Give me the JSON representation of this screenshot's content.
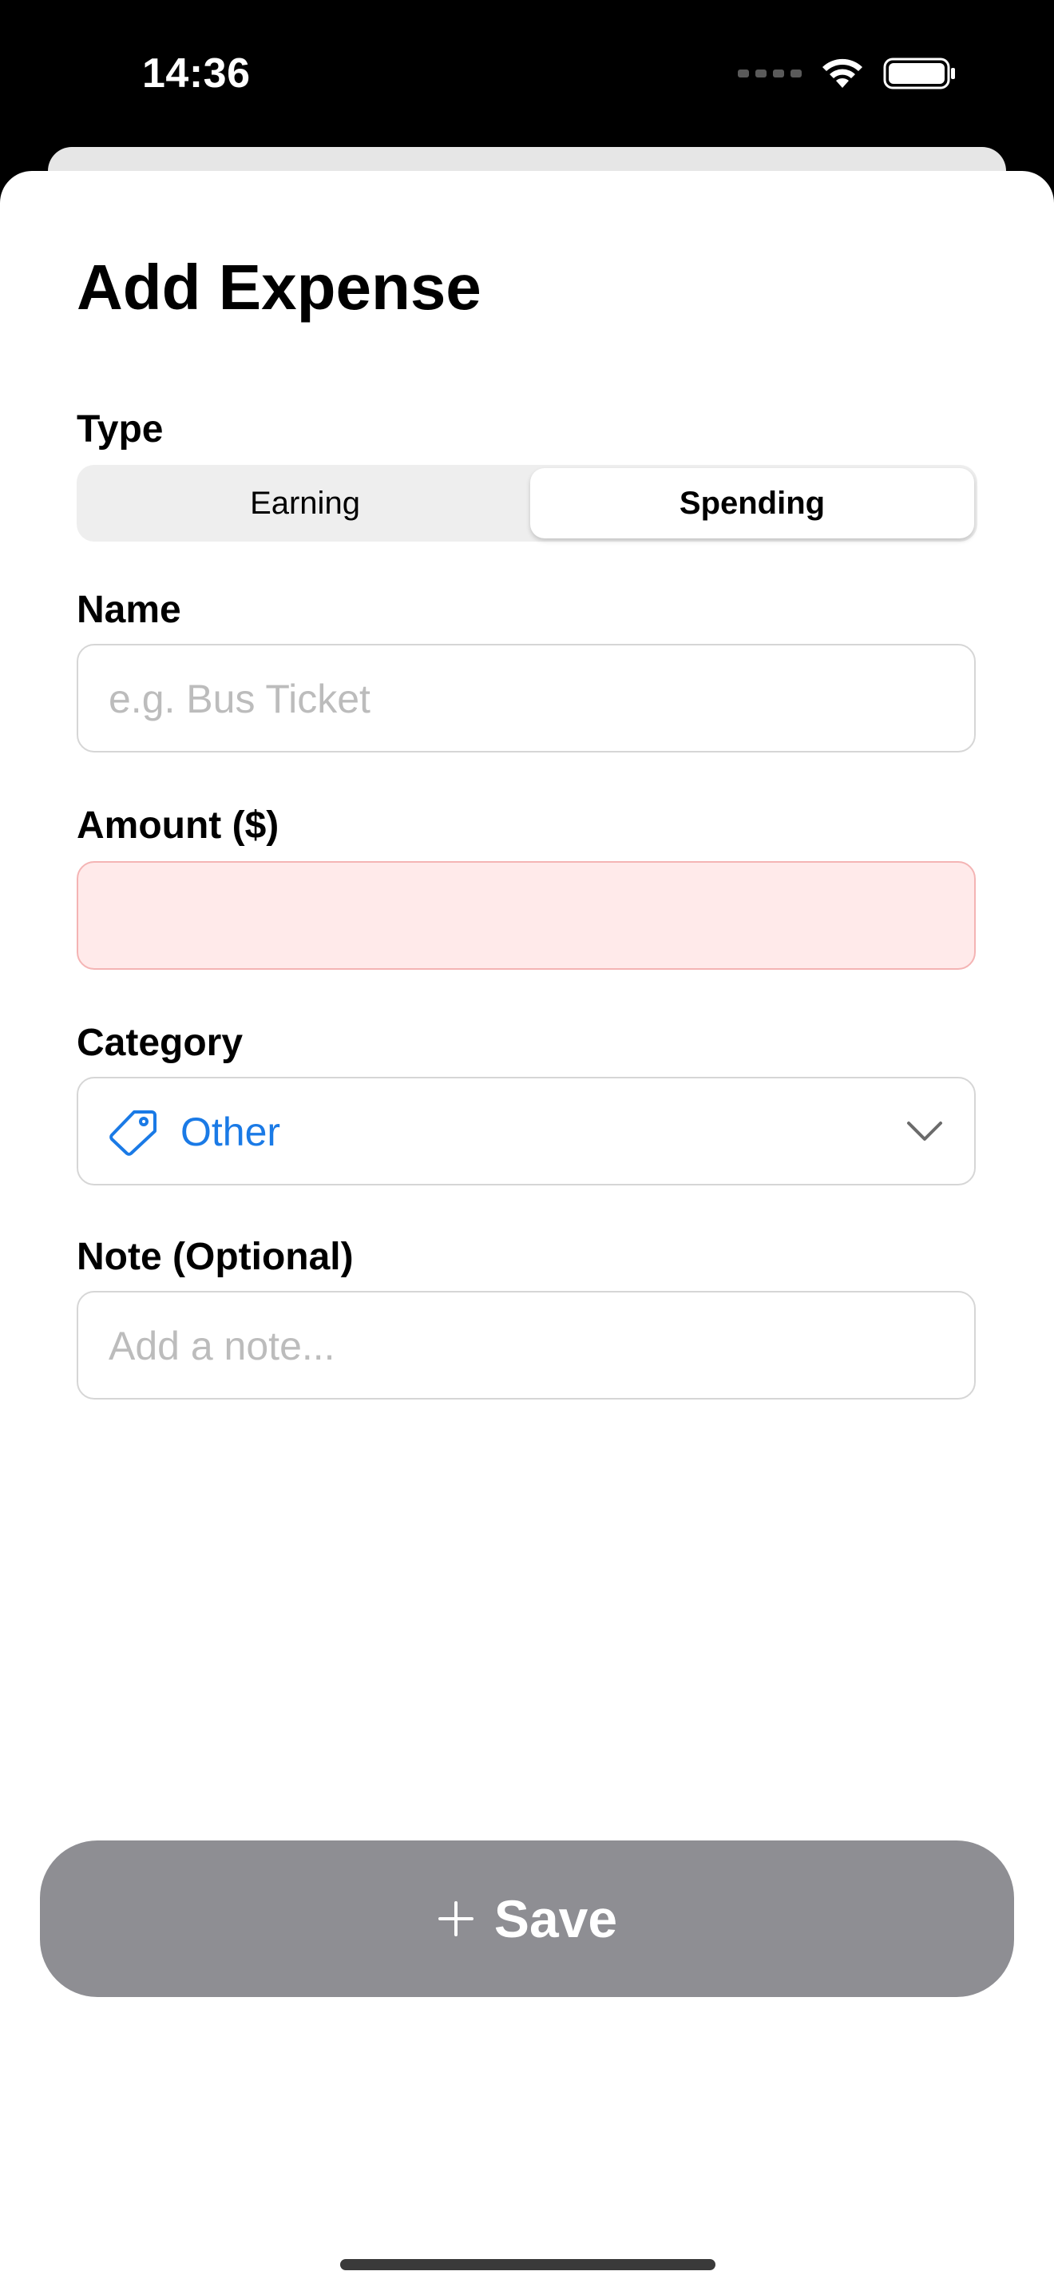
{
  "status_bar": {
    "time": "14:36"
  },
  "sheet": {
    "title": "Add Expense"
  },
  "type_field": {
    "label": "Type",
    "options": [
      "Earning",
      "Spending"
    ],
    "selected": "Spending"
  },
  "name_field": {
    "label": "Name",
    "value": "",
    "placeholder": "e.g. Bus Ticket"
  },
  "amount_field": {
    "label": "Amount ($)",
    "value": "",
    "placeholder": "",
    "state": "error"
  },
  "category_field": {
    "label": "Category",
    "value": "Other",
    "icon": "tag-icon"
  },
  "note_field": {
    "label": "Note (Optional)",
    "value": "",
    "placeholder": "Add a note..."
  },
  "save_button": {
    "label": "Save",
    "icon": "plus-icon",
    "state": "disabled"
  },
  "colors": {
    "accent": "#1a7ae6",
    "error_fill": "#ffeaea",
    "error_border": "#f4b4b4",
    "disabled_button": "#8e8e93"
  }
}
